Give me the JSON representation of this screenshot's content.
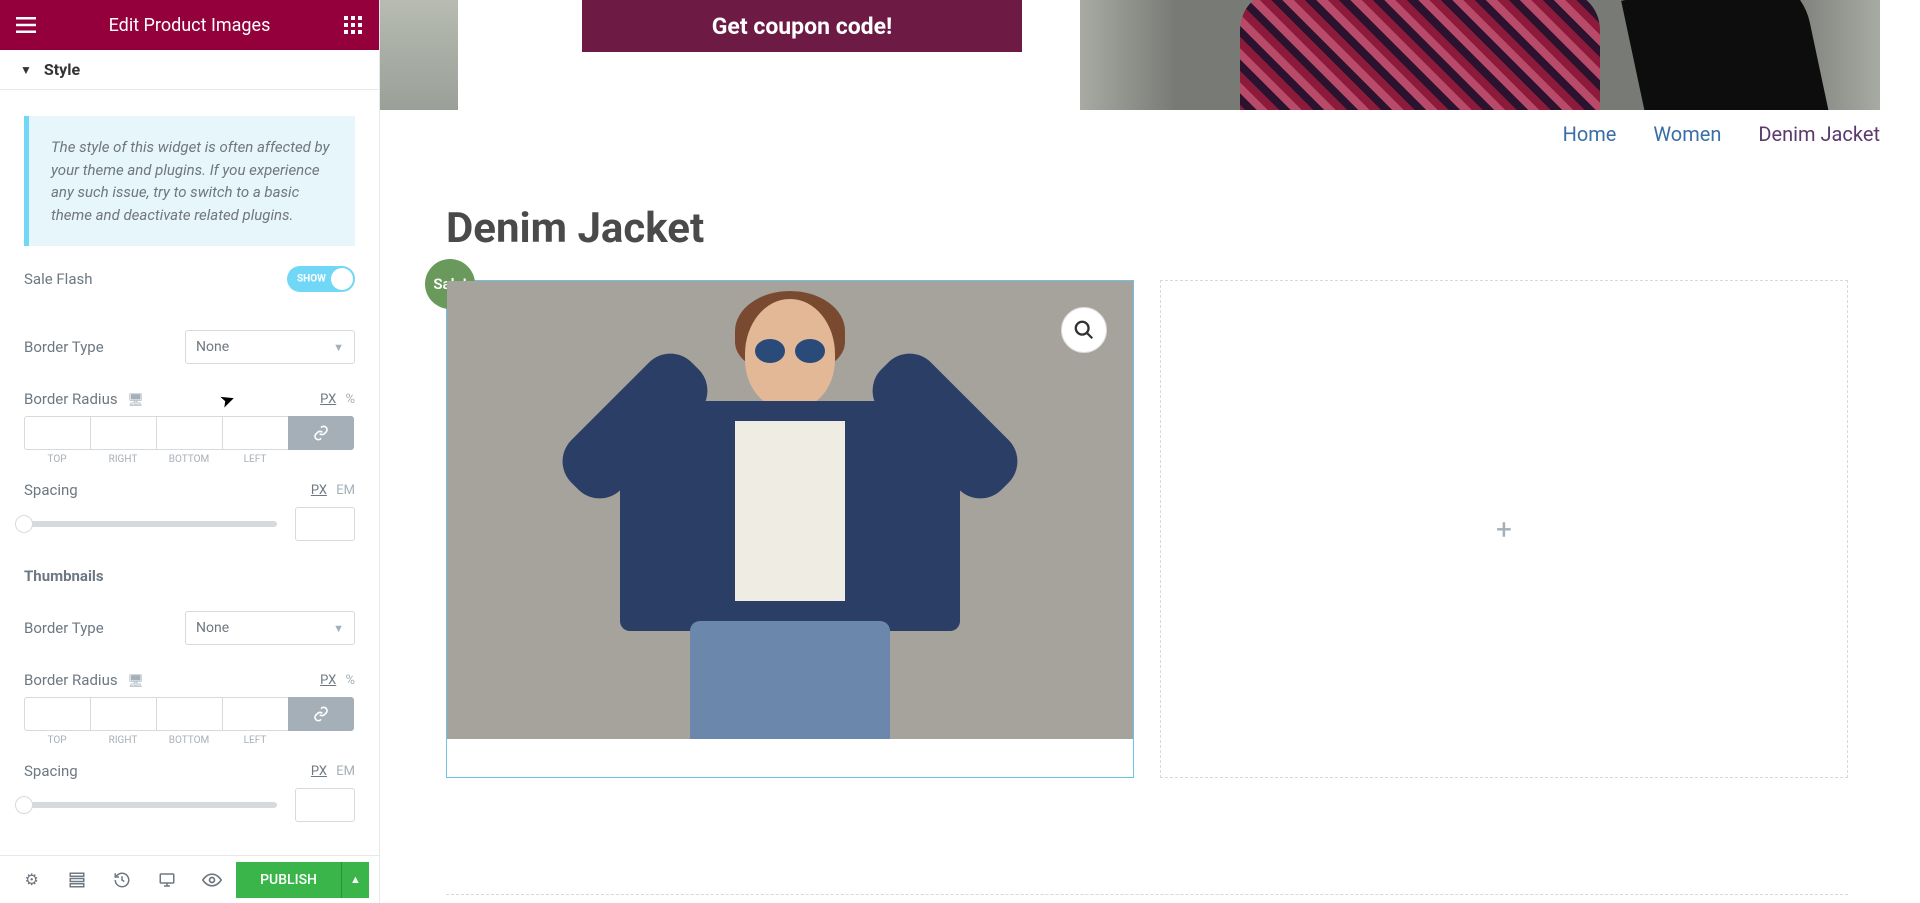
{
  "panel": {
    "title": "Edit Product Images",
    "section": "Style",
    "info": "The style of this widget is often affected by your theme and plugins. If you experience any such issue, try to switch to a basic theme and deactivate related plugins.",
    "sale_flash": {
      "label": "Sale Flash",
      "toggle": "SHOW"
    },
    "border_type": {
      "label": "Border Type",
      "value": "None"
    },
    "border_radius": {
      "label": "Border Radius",
      "unit_px": "PX",
      "unit_pct": "%",
      "top": "TOP",
      "right": "RIGHT",
      "bottom": "BOTTOM",
      "left": "LEFT"
    },
    "spacing": {
      "label": "Spacing",
      "unit_px": "PX",
      "unit_em": "EM"
    },
    "thumbnails": {
      "title": "Thumbnails",
      "border_type": {
        "label": "Border Type",
        "value": "None"
      },
      "border_radius": {
        "label": "Border Radius",
        "unit_px": "PX",
        "unit_pct": "%",
        "top": "TOP",
        "right": "RIGHT",
        "bottom": "BOTTOM",
        "left": "LEFT"
      },
      "spacing": {
        "label": "Spacing",
        "unit_px": "PX",
        "unit_em": "EM"
      }
    },
    "publish": "PUBLISH"
  },
  "preview": {
    "coupon": "Get coupon code!",
    "breadcrumb": {
      "home": "Home",
      "women": "Women",
      "current": "Denim Jacket"
    },
    "title": "Denim Jacket",
    "sale": "Sale!",
    "placeholder_plus": "+"
  }
}
